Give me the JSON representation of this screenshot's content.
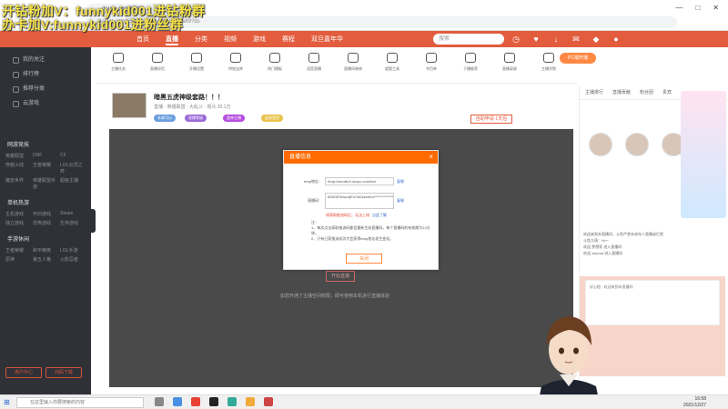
{
  "watermark": {
    "line1": "开钻粉加V：funnykid001进钻粉群",
    "line2": "办卡加V:funnykid001进粉丝群"
  },
  "browser": {
    "tab_title": "douyu.com/6582l",
    "url": "douyu.com/6582l/…?dyshid=…0.1589?ds"
  },
  "header": {
    "nav": [
      "首页",
      "直播",
      "分类",
      "视频",
      "游戏",
      "赛程",
      "双旦嘉年华"
    ],
    "active_nav": 1,
    "search_placeholder": "搜索"
  },
  "sidebar": {
    "top_items": [
      "我的关注",
      "排行榜",
      "推荐分类",
      "云游戏"
    ],
    "sections": [
      {
        "title": "网游竞技",
        "items": [
          "英雄联盟",
          "DNF",
          "CF",
          "穿越火线",
          "王者荣耀",
          "LOL云顶之弈",
          "魔兽世界",
          "英雄联盟手游",
          "超级主播"
        ]
      },
      {
        "title": "单机热游",
        "items": [
          "主机游戏",
          "怀旧游戏",
          "Steam",
          "独立游戏",
          "恐怖游戏",
          "生存游戏"
        ]
      },
      {
        "title": "手游休闲",
        "items": [
          "王者荣耀",
          "和平精英",
          "LOL手游",
          "原神",
          "第五人格",
          "火影忍者"
        ]
      }
    ],
    "buttons": [
      "用户中心",
      "扫码下载"
    ]
  },
  "tools": [
    "主播任务",
    "直播伴侣",
    "开播设置",
    "特效宝库",
    "热门模板",
    "语音直播",
    "直播间装修",
    "超管工具",
    "节目单",
    "下播推荐",
    "直播录屏",
    "主播学院"
  ],
  "pc_button": "PC端开播",
  "room": {
    "title": "暗黑五虎神级套路！！！",
    "subtitle": "直播 · 英雄联盟 · 大乱斗 · 观众 20.1万",
    "tags": [
      "本来可以",
      "直播等级",
      "超神主播",
      "连续签到"
    ],
    "apply_button": "自助申请·1天后"
  },
  "player": {
    "start_button": "开始直播",
    "tip": "如您开通了主播空间权限，即可使用本机进行直播体验"
  },
  "dialog": {
    "title": "直播信息",
    "rtmp_label": "rtmp地址：",
    "rtmp_value": "rtmp://sendtc3.douyu.com/live",
    "rtmp_copy": "复制",
    "code_label": "直播码：",
    "code_value": "6582l57kwoojlFs7wDsezebu****************",
    "code_copy": "复制",
    "warning": "如获取推流码后，无法上线",
    "warning_link": "点此了解",
    "note_title": "注：",
    "notes": [
      "1、每次点击获取推流码都会重新生成直播码，每个直播码的有效期为12分钟。",
      "2、只有已获推流成功才会获得rtmp地址发生变化。"
    ],
    "close_button": "关闭"
  },
  "right_panel": {
    "tabs": [
      "主播排行",
      "直播贡献",
      "粉丝团",
      "贵宾"
    ],
    "chat": [
      "欢迎来到本直播间，斗鱼严禁未成年人直播或打赏",
      "斗鱼大萌：Hi～",
      "欢迎 梦想家 进入直播间",
      "欢迎 xiaoma 进入直播间"
    ],
    "card_text": "好心橙 · 欢迎来到本直播间"
  },
  "taskbar": {
    "search": "在这里输入你要搜索的内容",
    "time": "16:58",
    "date": "2021/12/27"
  }
}
